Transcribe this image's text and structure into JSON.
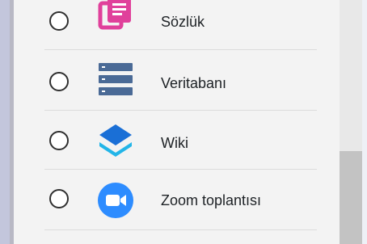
{
  "activity_chooser": {
    "items": [
      {
        "label": "Sözlük",
        "icon": "glossary-icon",
        "icon_color": "#e0409b"
      },
      {
        "label": "Veritabanı",
        "icon": "database-icon",
        "icon_color": "#4a6a96"
      },
      {
        "label": "Wiki",
        "icon": "wiki-layers-icon",
        "icon_color": "#1a8de0"
      },
      {
        "label": "Zoom toplantısı",
        "icon": "zoom-camera-icon",
        "icon_color": "#2d8cff"
      }
    ]
  }
}
